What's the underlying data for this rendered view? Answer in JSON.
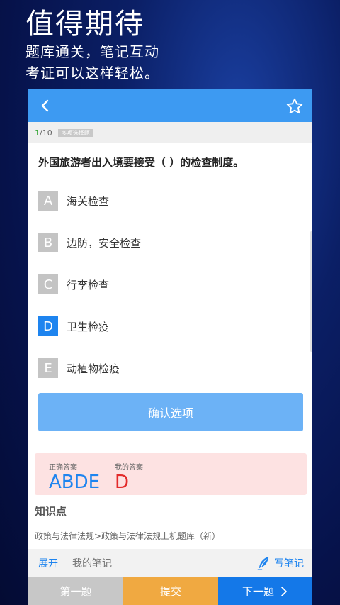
{
  "promo": {
    "headline": "值得期待",
    "line1": "题库通关，笔记互动",
    "line2": "考证可以这样轻松。"
  },
  "header": {
    "back_icon": "chevron-left-icon",
    "favorite_icon": "star-outline-icon",
    "color": "#3d9af2"
  },
  "progress": {
    "current": "1",
    "total": "/10",
    "type_tag": "多项选择题"
  },
  "question": {
    "text": "外国旅游者出入境要接受（ ）的检查制度。"
  },
  "options": [
    {
      "letter": "A",
      "text": "海关检查",
      "selected": false
    },
    {
      "letter": "B",
      "text": "边防，安全检查",
      "selected": false
    },
    {
      "letter": "C",
      "text": "行李检查",
      "selected": false
    },
    {
      "letter": "D",
      "text": "卫生检疫",
      "selected": true
    },
    {
      "letter": "E",
      "text": "动植物检疫",
      "selected": false
    }
  ],
  "confirm_button": "确认选项",
  "answer": {
    "correct_label": "正确答案",
    "correct_value": "ABDE",
    "mine_label": "我的答案",
    "mine_value": "D"
  },
  "knowledge": {
    "title": "知识点",
    "path": "政策与法律法规>政策与法律法规上机题库（新）"
  },
  "notes": {
    "expand": "展开",
    "my_notes": "我的笔记",
    "write": "写笔记",
    "write_icon": "quill-pen-icon"
  },
  "bottom_nav": {
    "prev": "第一题",
    "submit": "提交",
    "next": "下一题",
    "next_icon": "chevron-right-icon"
  }
}
